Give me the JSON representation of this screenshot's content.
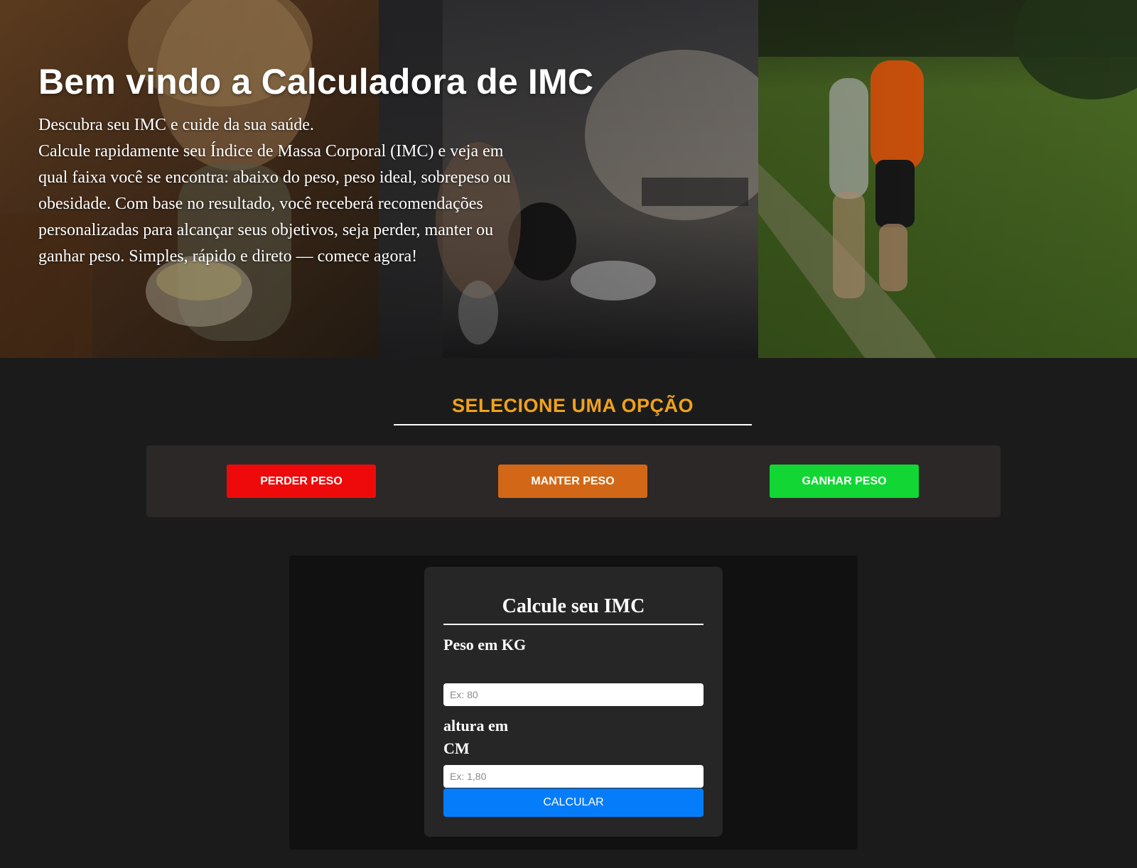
{
  "hero": {
    "title": "Bem vindo a Calculadora de IMC",
    "paragraph": "Descubra seu IMC e cuide da sua saúde.\nCalcule rapidamente seu Índice de Massa Corporal (IMC) e veja em qual faixa você se encontra: abaixo do peso, peso ideal, sobrepeso ou obesidade. Com base no resultado, você receberá recomendações personalizadas para alcançar seus objetivos, seja perder, manter ou ganhar peso. Simples, rápido e direto — comece agora!",
    "images": [
      "woman-eating-salad-photo",
      "gym-dumbbell-training-photo",
      "couple-running-park-photo"
    ]
  },
  "options": {
    "title": "SELECIONE UMA OPÇÃO",
    "buttons": [
      {
        "label": "PERDER PESO",
        "color": "#ee0a0a"
      },
      {
        "label": "MANTER PESO",
        "color": "#d26817"
      },
      {
        "label": "GANHAR PESO",
        "color": "#12d634"
      }
    ]
  },
  "calculator": {
    "title": "Calcule seu IMC",
    "weight_label": "Peso em KG",
    "weight_placeholder": "Ex: 80",
    "weight_value": "",
    "height_label": "altura em CM",
    "height_placeholder": "Ex: 1,80",
    "height_value": "",
    "submit_label": "CALCULAR",
    "submit_color": "#057dfa"
  },
  "colors": {
    "accent": "#f0a21b",
    "page_bg": "#1b1b1b"
  }
}
